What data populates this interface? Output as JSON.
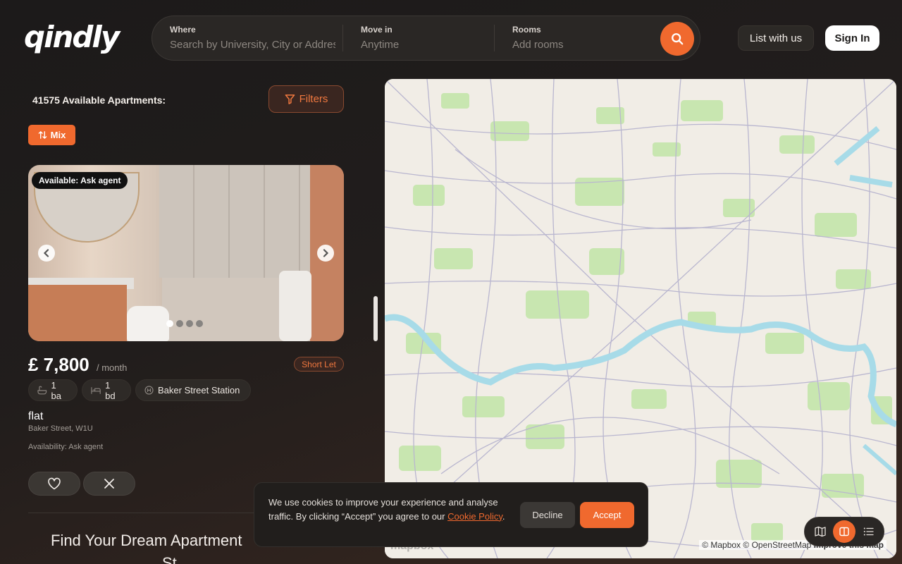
{
  "brand": {
    "logo_text": "qindly",
    "accent": "#f0692e"
  },
  "search": {
    "where_label": "Where",
    "where_placeholder": "Search by University, City or Address",
    "move_label": "Move in",
    "move_placeholder": "Anytime",
    "rooms_label": "Rooms",
    "rooms_placeholder": "Add rooms",
    "button_icon": "search-icon"
  },
  "header": {
    "list_label": "List with us",
    "signin_label": "Sign In"
  },
  "results": {
    "count_title": "41575 Available Apartments:",
    "filters_label": "Filters",
    "sort_label": "Mix"
  },
  "listing": {
    "availability_badge": "Available: Ask agent",
    "price": "£ 7,800",
    "per": "/ month",
    "tag": "Short Let",
    "baths": "1 ba",
    "beds": "1 bd",
    "station": "Baker Street Station",
    "type": "flat",
    "address": "Baker Street, W1U",
    "availability": "Availability: Ask agent",
    "image_count": 4,
    "active_image": 1
  },
  "promo": {
    "line1": "Find Your Dream Apartment",
    "line2": "St"
  },
  "map": {
    "attribution_mapbox": "© Mapbox",
    "attribution_osm": "© OpenStreetMap",
    "improve": "Improve this map",
    "logo": "mapbox",
    "water_color": "#a7dbe8",
    "park_color": "#c8e6b0",
    "road_color": "#b9b6cf"
  },
  "cookie": {
    "text": "We use cookies to improve your experience and analyse traffic. By clicking “Accept” you agree to our ",
    "link": "Cookie Policy",
    "end": ".",
    "decline": "Decline",
    "accept": "Accept"
  }
}
